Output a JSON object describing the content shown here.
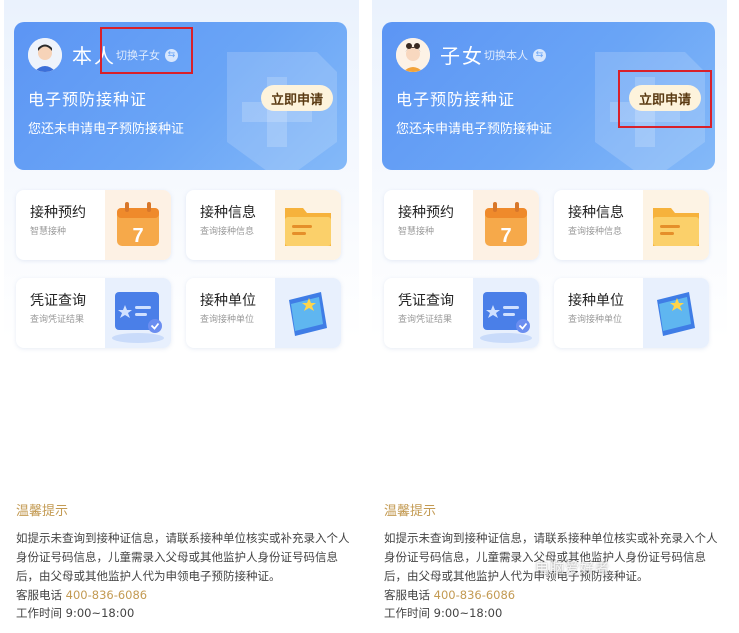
{
  "panels": [
    {
      "name": "本人",
      "switch_label": "切换子女",
      "avatar": "adult-avatar",
      "cert_title": "电子预防接种证",
      "cert_subtitle": "您还未申请电子预防接种证",
      "apply_label": "立即申请",
      "cards": [
        {
          "title": "接种预约",
          "subtitle": "智慧接种",
          "icon": "calendar-icon",
          "number": "7"
        },
        {
          "title": "接种信息",
          "subtitle": "查询接种信息",
          "icon": "folder-icon"
        },
        {
          "title": "凭证查询",
          "subtitle": "查询凭证结果",
          "icon": "certificate-icon"
        },
        {
          "title": "接种单位",
          "subtitle": "查询接种单位",
          "icon": "book-star-icon"
        }
      ],
      "tips": {
        "title": "温馨提示",
        "body": "如提示未查询到接种证信息，请联系接种单位核实或补充录入个人身份证号码信息，儿童需录入父母或其他监护人身份证号码信息后，由父母或其他监护人代为申领电子预防接种证。",
        "phone_label": "客服电话",
        "phone": "400-836-6086",
        "hours_label": "工作时间",
        "hours": "9:00~18:00"
      }
    },
    {
      "name": "子女",
      "switch_label": "切换本人",
      "avatar": "child-avatar",
      "cert_title": "电子预防接种证",
      "cert_subtitle": "您还未申请电子预防接种证",
      "apply_label": "立即申请",
      "cards": [
        {
          "title": "接种预约",
          "subtitle": "智慧接种",
          "icon": "calendar-icon",
          "number": "7"
        },
        {
          "title": "接种信息",
          "subtitle": "查询接种信息",
          "icon": "folder-icon"
        },
        {
          "title": "凭证查询",
          "subtitle": "查询凭证结果",
          "icon": "certificate-icon"
        },
        {
          "title": "接种单位",
          "subtitle": "查询接种单位",
          "icon": "book-star-icon"
        }
      ],
      "tips": {
        "title": "温馨提示",
        "body": "如提示未查询到接种证信息，请联系接种单位核实或补充录入个人身份证号码信息，儿童需录入父母或其他监护人身份证号码信息后，由父母或其他监护人代为申领电子预防接种证。",
        "phone_label": "客服电话",
        "phone": "400-836-6086",
        "hours_label": "工作时间",
        "hours": "9:00~18:00"
      }
    }
  ],
  "watermark": "电脑爱好者",
  "colors": {
    "banner_blue": "#5c95f4",
    "apply_button_bg": "#fdf3dc",
    "tips_gold": "#c39a52",
    "highlight_red": "#d8202a"
  }
}
